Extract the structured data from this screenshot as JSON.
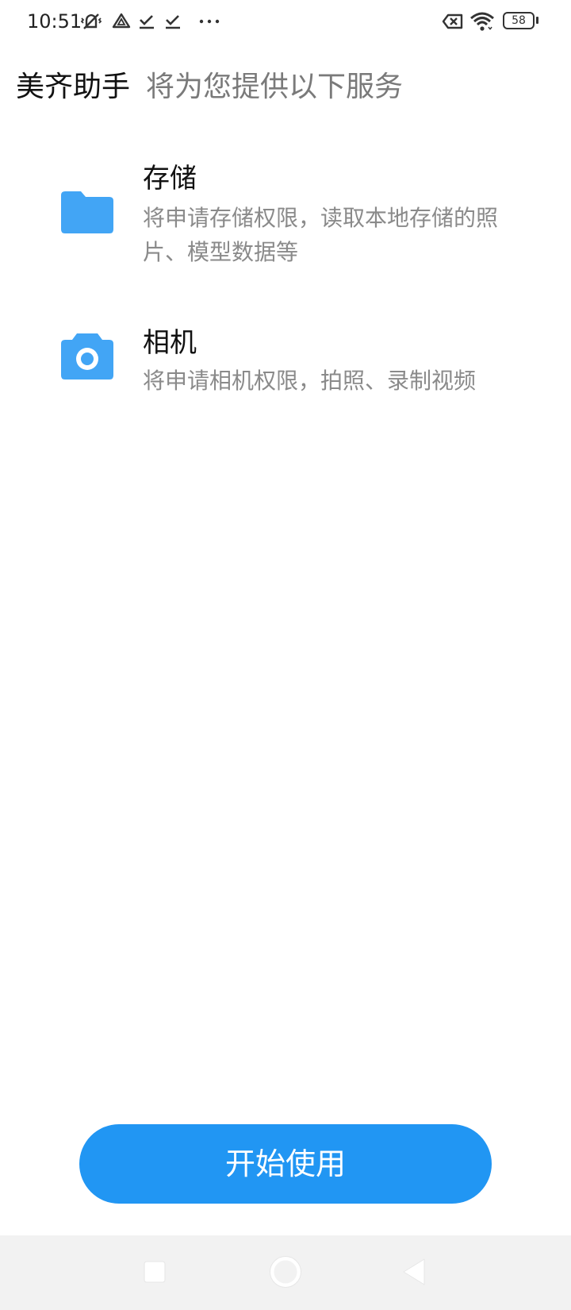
{
  "status_bar": {
    "time": "10:51",
    "battery_level": "58",
    "icons": [
      "mute-vibrate-icon",
      "drive-icon",
      "download-done-icon",
      "download-done-icon",
      "more-dots-icon",
      "no-sim-icon",
      "wifi-icon",
      "battery-icon"
    ]
  },
  "header": {
    "app_name": "美齐助手",
    "subtitle": "将为您提供以下服务"
  },
  "permissions": [
    {
      "icon": "folder-icon",
      "title": "存储",
      "description": "将申请存储权限，读取本地存储的照片、模型数据等"
    },
    {
      "icon": "camera-icon",
      "title": "相机",
      "description": "将申请相机权限，拍照、录制视频"
    }
  ],
  "start_button_label": "开始使用",
  "nav_bar": {
    "buttons": [
      "recents-square-icon",
      "home-circle-icon",
      "back-triangle-icon"
    ]
  },
  "colors": {
    "accent": "#2196f3",
    "icon_blue": "#42a5f5",
    "secondary_text": "#8a8a8a"
  }
}
